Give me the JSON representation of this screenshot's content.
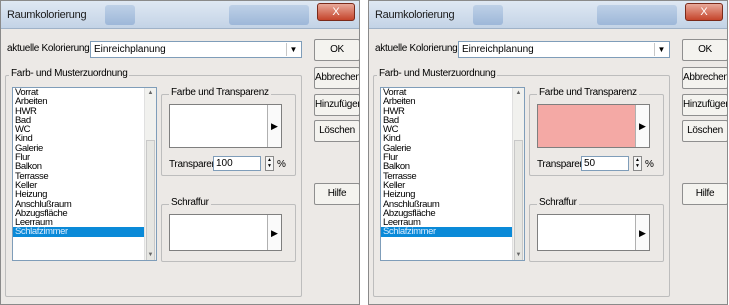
{
  "dialogs": [
    {
      "title": "Raumkolorierung",
      "close_label": "X",
      "coloring_label": "aktuelle Kolorierung:",
      "coloring_value": "Einreichplanung",
      "group_label": "Farb- und Musterzuordnung",
      "fill_group_label": "Farbe und Transparenz",
      "transparency_label": "Transparenz",
      "transparency_value": "100",
      "percent": "%",
      "hatch_label": "Schraffur",
      "swatch_color": "#ffffff",
      "buttons": {
        "ok": "OK",
        "cancel": "Abbrechen",
        "add": "Hinzufügen...",
        "delete": "Löschen",
        "help": "Hilfe"
      },
      "rooms": [
        "Vorrat",
        "Arbeiten",
        "HWR",
        "Bad",
        "WC",
        "Kind",
        "Galerie",
        "Flur",
        "Balkon",
        "Terrasse",
        "Keller",
        "Heizung",
        "Anschlußraum",
        "Abzugsfläche",
        "Leerraum",
        "Schlafzimmer"
      ],
      "selected_room": "Schlafzimmer"
    },
    {
      "title": "Raumkolorierung",
      "close_label": "X",
      "coloring_label": "aktuelle Kolorierung:",
      "coloring_value": "Einreichplanung",
      "group_label": "Farb- und Musterzuordnung",
      "fill_group_label": "Farbe und Transparenz",
      "transparency_label": "Transparenz",
      "transparency_value": "50",
      "percent": "%",
      "hatch_label": "Schraffur",
      "swatch_color": "#f4a9a5",
      "buttons": {
        "ok": "OK",
        "cancel": "Abbrechen",
        "add": "Hinzufügen...",
        "delete": "Löschen",
        "help": "Hilfe"
      },
      "rooms": [
        "Vorrat",
        "Arbeiten",
        "HWR",
        "Bad",
        "WC",
        "Kind",
        "Galerie",
        "Flur",
        "Balkon",
        "Terrasse",
        "Keller",
        "Heizung",
        "Anschlußraum",
        "Abzugsfläche",
        "Leerraum",
        "Schlafzimmer"
      ],
      "selected_room": "Schlafzimmer"
    }
  ]
}
